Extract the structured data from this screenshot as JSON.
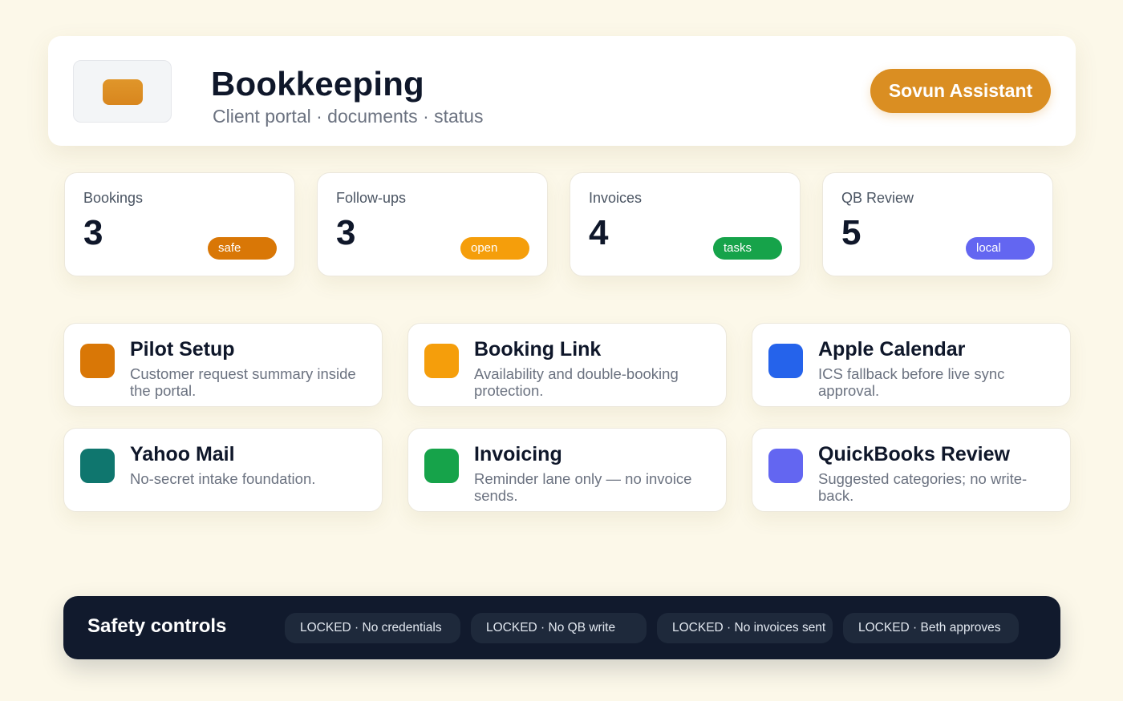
{
  "header": {
    "title": "Bookkeeping",
    "subtitle": "Client portal · documents · status",
    "assistant_button": "Sovun Assistant",
    "logo_icon": "rounded-block-logo-icon",
    "accent_color": "#da8e22"
  },
  "stats": [
    {
      "label": "Bookings",
      "value": "3",
      "badge": "safe",
      "badge_color": "#d97706"
    },
    {
      "label": "Follow-ups",
      "value": "3",
      "badge": "open",
      "badge_color": "#f59e0b"
    },
    {
      "label": "Invoices",
      "value": "4",
      "badge": "tasks",
      "badge_color": "#16a34a"
    },
    {
      "label": "QB Review",
      "value": "5",
      "badge": "local",
      "badge_color": "#6366f1"
    }
  ],
  "features": [
    {
      "title": "Pilot Setup",
      "description": "Customer request summary inside the portal.",
      "color": "#d97706"
    },
    {
      "title": "Booking Link",
      "description": "Availability and double-booking protection.",
      "color": "#f59e0b"
    },
    {
      "title": "Apple Calendar",
      "description": "ICS fallback before live sync approval.",
      "color": "#2563eb"
    },
    {
      "title": "Yahoo Mail",
      "description": "No-secret intake foundation.",
      "color": "#0f766e"
    },
    {
      "title": "Invoicing",
      "description": "Reminder lane only — no invoice sends.",
      "color": "#16a34a"
    },
    {
      "title": "QuickBooks Review",
      "description": "Suggested categories; no write-back.",
      "color": "#6366f1"
    }
  ],
  "safety": {
    "title": "Safety controls",
    "chips": [
      "LOCKED · No credentials",
      "LOCKED · No QB write",
      "LOCKED · No invoices sent",
      "LOCKED · Beth approves"
    ]
  }
}
